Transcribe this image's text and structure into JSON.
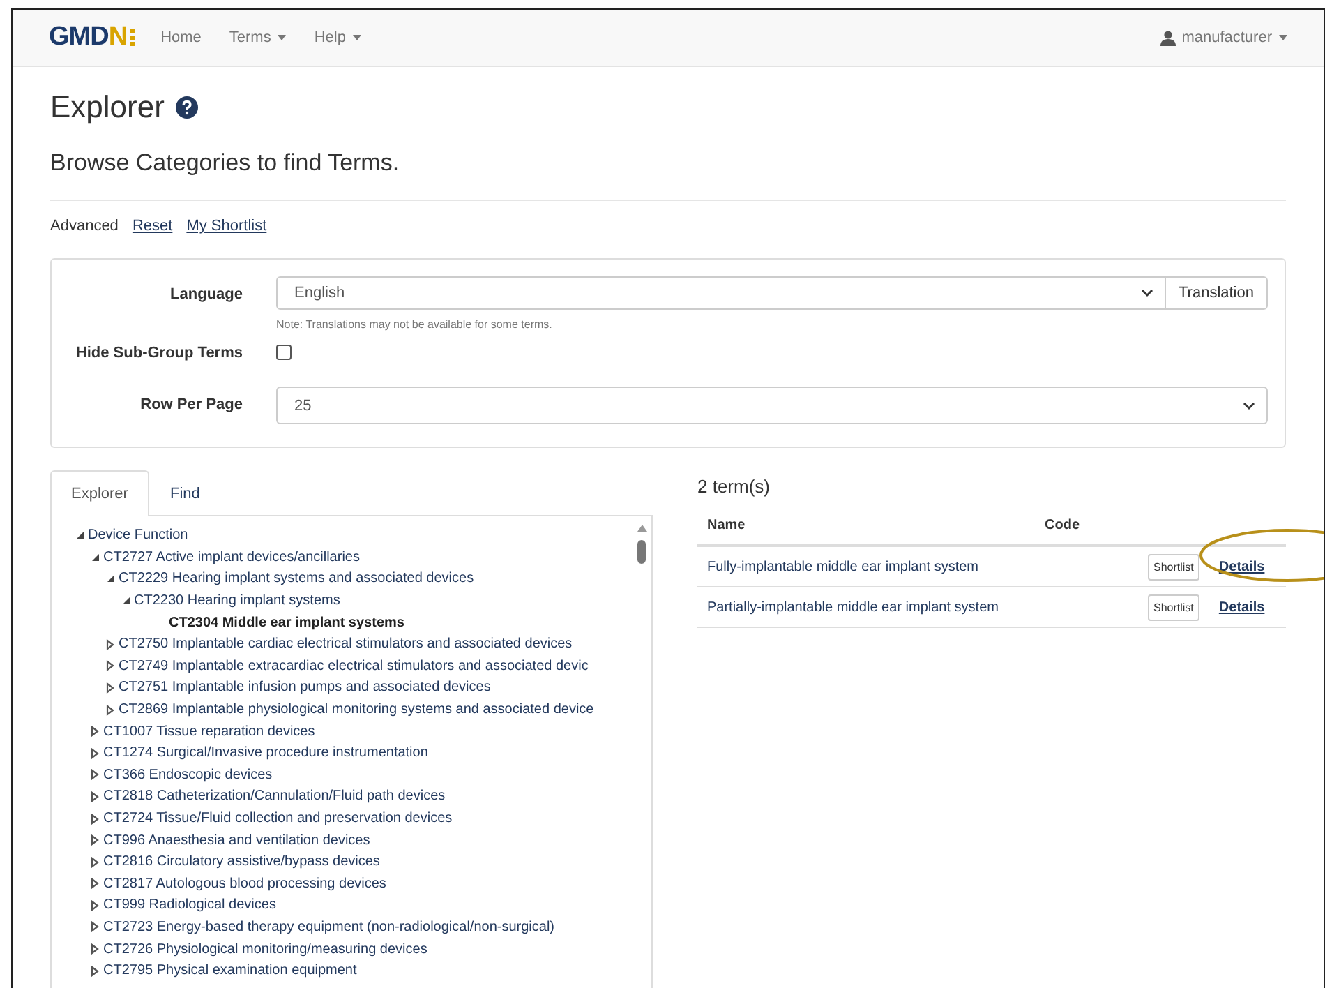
{
  "navbar": {
    "logo": {
      "text": "GMDN"
    },
    "links": [
      {
        "label": "Home",
        "dropdown": false
      },
      {
        "label": "Terms",
        "dropdown": true
      },
      {
        "label": "Help",
        "dropdown": true
      }
    ],
    "user": "manufacturer"
  },
  "page": {
    "title": "Explorer",
    "subtitle": "Browse Categories to find Terms.",
    "actions": [
      {
        "label": "Advanced",
        "kind": "text"
      },
      {
        "label": "Reset",
        "kind": "link"
      },
      {
        "label": "My Shortlist",
        "kind": "link"
      }
    ]
  },
  "filters": {
    "language": {
      "label": "Language",
      "value": "English",
      "button": "Translation",
      "note": "Note: Translations may not be available for some terms."
    },
    "hide_subgroup": {
      "label": "Hide Sub-Group Terms",
      "checked": false
    },
    "rows_per_page": {
      "label": "Row Per Page",
      "value": "25"
    }
  },
  "tabs": [
    {
      "label": "Explorer",
      "selected": true
    },
    {
      "label": "Find",
      "selected": false
    }
  ],
  "tree": [
    {
      "label": "Device Function",
      "expanded": true,
      "selected": false,
      "children": [
        {
          "label": "CT2727 Active implant devices/ancillaries",
          "expanded": true,
          "selected": false,
          "children": [
            {
              "label": "CT2229 Hearing implant systems and associated devices",
              "expanded": true,
              "selected": false,
              "children": [
                {
                  "label": "CT2230 Hearing implant systems",
                  "expanded": true,
                  "selected": false,
                  "children": [
                    {
                      "label": "CT2304 Middle ear implant systems",
                      "selected": true
                    }
                  ]
                }
              ]
            },
            {
              "label": "CT2750 Implantable cardiac electrical stimulators and associated devices",
              "expanded": false,
              "selected": false
            },
            {
              "label": "CT2749 Implantable extracardiac electrical stimulators and associated devic",
              "expanded": false,
              "selected": false
            },
            {
              "label": "CT2751 Implantable infusion pumps and associated devices",
              "expanded": false,
              "selected": false
            },
            {
              "label": "CT2869 Implantable physiological monitoring systems and associated device",
              "expanded": false,
              "selected": false
            }
          ]
        },
        {
          "label": "CT1007 Tissue reparation devices",
          "expanded": false,
          "selected": false
        },
        {
          "label": "CT1274 Surgical/Invasive procedure instrumentation",
          "expanded": false,
          "selected": false
        },
        {
          "label": "CT366 Endoscopic devices",
          "expanded": false,
          "selected": false
        },
        {
          "label": "CT2818 Catheterization/Cannulation/Fluid path devices",
          "expanded": false,
          "selected": false
        },
        {
          "label": "CT2724 Tissue/Fluid collection and preservation devices",
          "expanded": false,
          "selected": false
        },
        {
          "label": "CT996 Anaesthesia and ventilation devices",
          "expanded": false,
          "selected": false
        },
        {
          "label": "CT2816 Circulatory assistive/bypass devices",
          "expanded": false,
          "selected": false
        },
        {
          "label": "CT2817 Autologous blood processing devices",
          "expanded": false,
          "selected": false
        },
        {
          "label": "CT999 Radiological devices",
          "expanded": false,
          "selected": false
        },
        {
          "label": "CT2723 Energy-based therapy equipment (non-radiological/non-surgical)",
          "expanded": false,
          "selected": false
        },
        {
          "label": "CT2726 Physiological monitoring/measuring devices",
          "expanded": false,
          "selected": false
        },
        {
          "label": "CT2795 Physical examination equipment",
          "expanded": false,
          "selected": false
        }
      ]
    }
  ],
  "results": {
    "count": "2 term(s)",
    "columns": [
      "Name",
      "Code"
    ],
    "rows": [
      {
        "name": "Fully-implantable middle ear implant system",
        "shortlist": "Shortlist",
        "details": "Details",
        "highlighted": true
      },
      {
        "name": "Partially-implantable middle ear implant system",
        "shortlist": "Shortlist",
        "details": "Details",
        "highlighted": false
      }
    ]
  }
}
